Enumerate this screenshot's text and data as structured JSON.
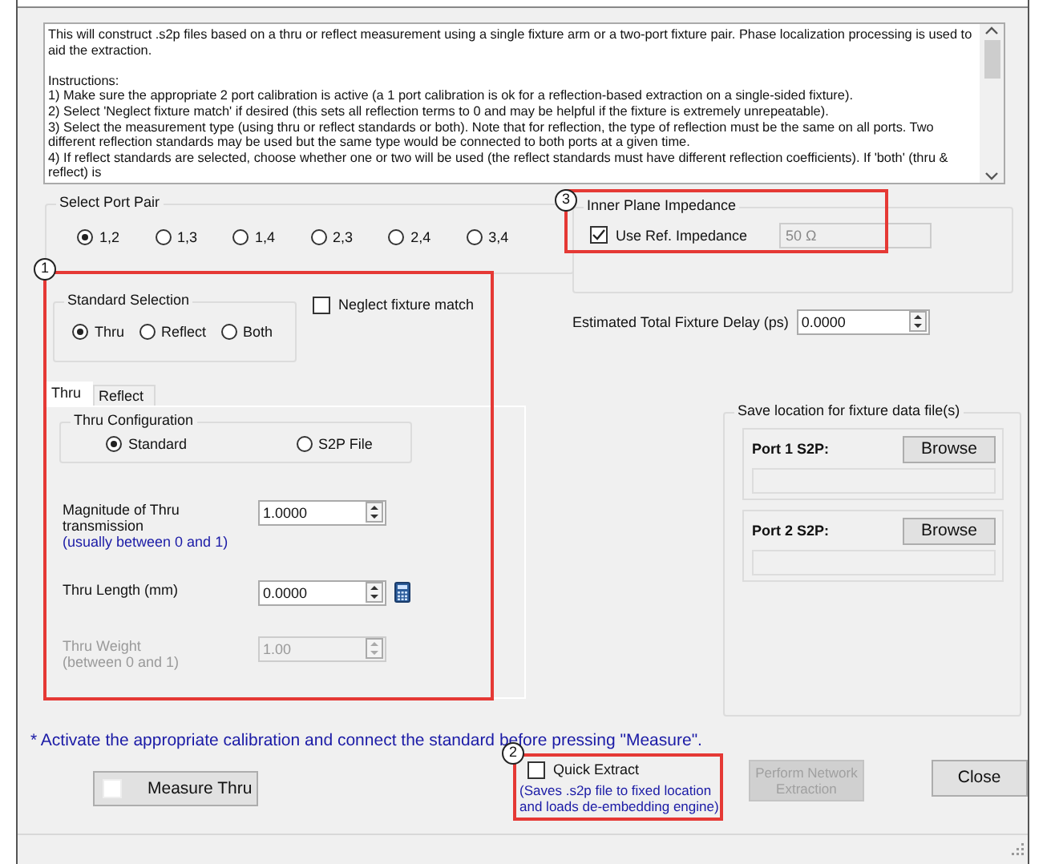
{
  "description": {
    "intro": "This will construct .s2p files based on a thru or reflect measurement using a single fixture arm or a two-port fixture pair.  Phase localization processing is used to aid the extraction.",
    "lines": [
      "Instructions:",
      "1) Make sure the appropriate 2 port calibration is active (a 1 port calibration is ok for a reflection-based extraction on a single-sided fixture).",
      "2) Select 'Neglect fixture match' if desired (this sets all reflection terms to 0 and may be helpful if the fixture is extremely unrepeatable).",
      "3) Select the measurement type (using thru or reflect standards or both).  Note that for reflection, the type of reflection must be the same on all ports.  Two different reflection standards may be used but the same type would be connected to both ports at a given time.",
      "4) If reflect standards are selected, choose whether one or two will be used (the reflect standards must have different reflection coefficients).  If 'both' (thru & reflect) is"
    ]
  },
  "port_pair": {
    "label": "Select Port Pair",
    "options": [
      {
        "label": "1,2",
        "selected": true
      },
      {
        "label": "1,3",
        "selected": false
      },
      {
        "label": "1,4",
        "selected": false
      },
      {
        "label": "2,3",
        "selected": false
      },
      {
        "label": "2,4",
        "selected": false
      },
      {
        "label": "3,4",
        "selected": false
      }
    ]
  },
  "standard_selection": {
    "label": "Standard Selection",
    "options": [
      {
        "label": "Thru",
        "selected": true
      },
      {
        "label": "Reflect",
        "selected": false
      },
      {
        "label": "Both",
        "selected": false
      }
    ]
  },
  "neglect_fixture_match": {
    "label": "Neglect fixture match",
    "checked": false
  },
  "tabs": [
    {
      "label": "Thru",
      "selected": true
    },
    {
      "label": "Reflect",
      "selected": false
    }
  ],
  "thru_configuration": {
    "label": "Thru Configuration",
    "options": [
      {
        "label": "Standard",
        "selected": true
      },
      {
        "label": "S2P File",
        "selected": false
      }
    ]
  },
  "fields": [
    {
      "label": "Magnitude of Thru transmission",
      "hint": "(usually between 0 and 1)",
      "value": "1.0000",
      "disabled": false
    },
    {
      "label": "Thru Length (mm)",
      "value": "0.0000",
      "disabled": false,
      "calculator": true
    },
    {
      "label": "Thru Weight",
      "hint": "(between 0 and 1)",
      "value": "1.00",
      "disabled": true
    }
  ],
  "inner_plane_impedance": {
    "label": "Inner Plane Impedance",
    "checkbox": {
      "label": "Use Ref. Impedance",
      "checked": true
    },
    "value": "50 Ω",
    "disabled": true
  },
  "fixture_delay": {
    "label": "Estimated Total Fixture Delay  (ps)",
    "value": "0.0000"
  },
  "save_location": {
    "label": "Save location for fixture data file(s)",
    "ports": [
      {
        "label": "Port 1 S2P:",
        "button": "Browse"
      },
      {
        "label": "Port 2 S2P:",
        "button": "Browse"
      }
    ]
  },
  "note": "* Activate the appropriate calibration and connect the standard before pressing \"Measure\".",
  "measure_button": "Measure Thru",
  "quick_extract": {
    "label": "Quick Extract",
    "checked": false,
    "hint_lines": [
      "(Saves .s2p file to fixed location",
      "and loads de-embedding engine)"
    ]
  },
  "perform_button": {
    "label": "Perform Network Extraction",
    "disabled": true
  },
  "close_button": "Close",
  "annotations": [
    {
      "number": "1"
    },
    {
      "number": "2"
    },
    {
      "number": "3"
    }
  ]
}
